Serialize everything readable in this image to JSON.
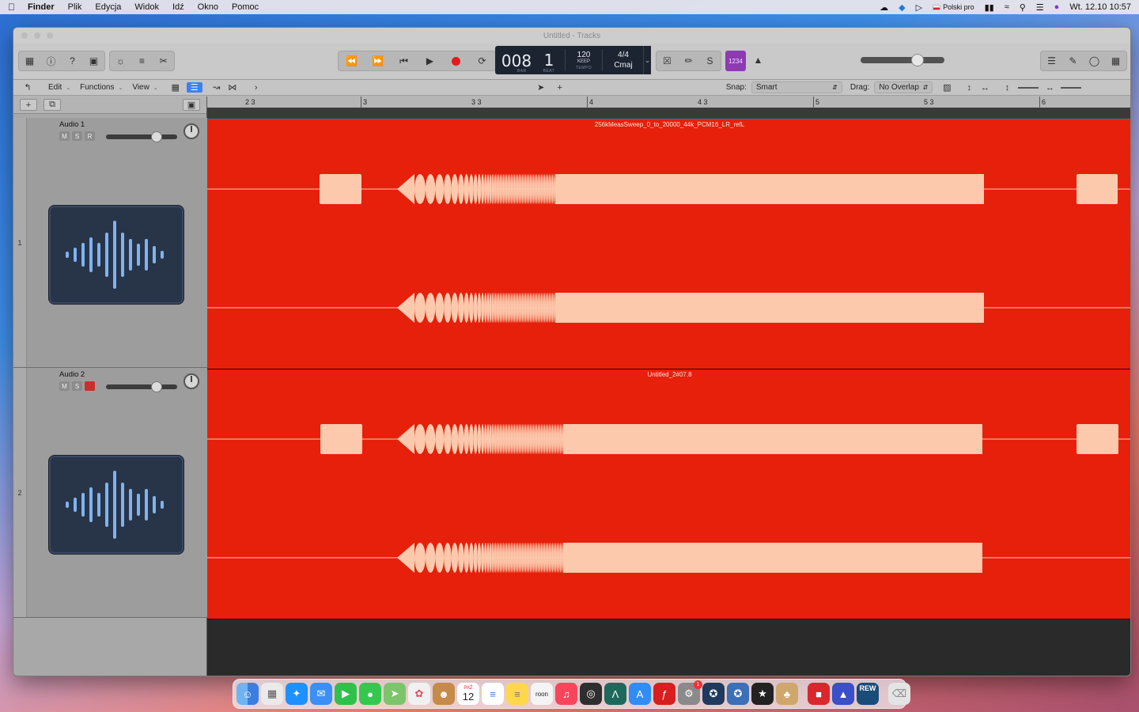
{
  "menubar": {
    "apple_icon": "apple-logo",
    "items": [
      "Finder",
      "Plik",
      "Edycja",
      "Widok",
      "Idź",
      "Okno",
      "Pomoc"
    ],
    "input_source": "Polski pro",
    "datetime": "Wt. 12.10  10:57"
  },
  "window": {
    "title": "Untitled - Tracks"
  },
  "lcd": {
    "bar_prefix": "00",
    "bar": "8",
    "beat": "1",
    "bar_label": "BAR",
    "beat_label": "BEAT",
    "tempo": "120",
    "tempo_keep": "KEEP",
    "tempo_label": "TEMPO",
    "time_signature": "4/4",
    "key": "Cmaj"
  },
  "count_in": "1234",
  "tracks_toolbar": {
    "edit": "Edit",
    "functions": "Functions",
    "view": "View",
    "snap_label": "Snap:",
    "snap_value": "Smart",
    "drag_label": "Drag:",
    "drag_value": "No Overlap"
  },
  "ruler": {
    "labels": [
      "2 3",
      "3",
      "3 3",
      "4",
      "4 3",
      "5",
      "5 3",
      "6"
    ]
  },
  "tracks": [
    {
      "number": "1",
      "name": "Audio 1",
      "mute": "M",
      "solo": "S",
      "record": "R",
      "region_name": "256kMeasSweep_0_to_20000_44k_PCM16_LR_refL",
      "volume_level": 0.7
    },
    {
      "number": "2",
      "name": "Audio 2",
      "mute": "M",
      "solo": "S",
      "record": "",
      "region_name": "Untitled_2#07.8",
      "volume_level": 0.7
    }
  ],
  "master_volume_level": 0.65,
  "colors": {
    "region": "#e6200b",
    "waveform": "#fcc9ad",
    "lcd_bg": "#1d2431",
    "count_in": "#8e3ab3",
    "selected_tool": "#3d7ff4"
  },
  "dock": {
    "apps": [
      "finder",
      "launchpad",
      "safari",
      "mail",
      "facetime",
      "messages",
      "maps",
      "photos",
      "contacts",
      "calendar",
      "reminders",
      "notes",
      "roon",
      "music",
      "logic-pro",
      "audacity",
      "app-store",
      "flash",
      "system-preferences",
      "app-icon",
      "app-icon",
      "app-icon",
      "app-icon",
      "affinity",
      "rew",
      "trash"
    ],
    "calendar_month": "PAŹ",
    "calendar_day": "12",
    "roon_label": "roon",
    "rew_label": "REW",
    "badge_count": "1"
  }
}
